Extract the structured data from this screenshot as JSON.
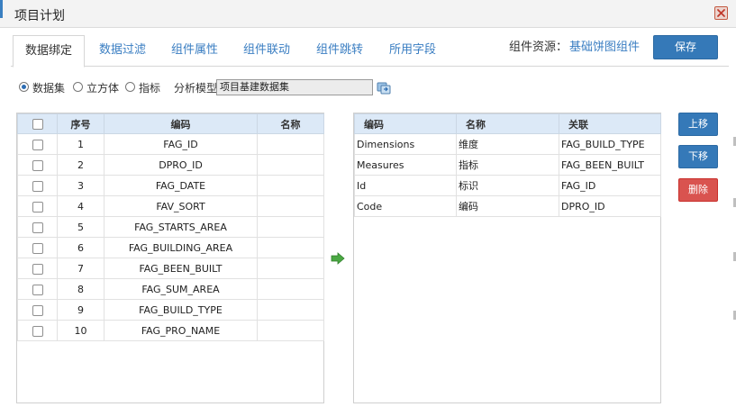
{
  "window": {
    "title": "项目计划"
  },
  "tabs": [
    {
      "label": "数据绑定",
      "active": true
    },
    {
      "label": "数据过滤",
      "active": false
    },
    {
      "label": "组件属性",
      "active": false
    },
    {
      "label": "组件联动",
      "active": false
    },
    {
      "label": "组件跳转",
      "active": false
    },
    {
      "label": "所用字段",
      "active": false
    }
  ],
  "component_resource": {
    "label": "组件资源：",
    "value": "基础饼图组件"
  },
  "toolbar": {
    "save_label": "保存"
  },
  "source_options": [
    {
      "label": "数据集",
      "selected": true
    },
    {
      "label": "立方体",
      "selected": false
    },
    {
      "label": "指标",
      "selected": false
    }
  ],
  "model": {
    "label": "分析模型",
    "value": "项目基建数据集"
  },
  "left_table": {
    "headers": {
      "index": "序号",
      "code": "编码",
      "name": "名称"
    },
    "rows": [
      {
        "index": "1",
        "code": "FAG_ID",
        "name": ""
      },
      {
        "index": "2",
        "code": "DPRO_ID",
        "name": ""
      },
      {
        "index": "3",
        "code": "FAG_DATE",
        "name": ""
      },
      {
        "index": "4",
        "code": "FAV_SORT",
        "name": ""
      },
      {
        "index": "5",
        "code": "FAG_STARTS_AREA",
        "name": ""
      },
      {
        "index": "6",
        "code": "FAG_BUILDING_AREA",
        "name": ""
      },
      {
        "index": "7",
        "code": "FAG_BEEN_BUILT",
        "name": ""
      },
      {
        "index": "8",
        "code": "FAG_SUM_AREA",
        "name": ""
      },
      {
        "index": "9",
        "code": "FAG_BUILD_TYPE",
        "name": ""
      },
      {
        "index": "10",
        "code": "FAG_PRO_NAME",
        "name": ""
      }
    ]
  },
  "right_table": {
    "headers": {
      "code": "编码",
      "name": "名称",
      "link": "关联"
    },
    "rows": [
      {
        "code": "Dimensions",
        "name": "维度",
        "link": "FAG_BUILD_TYPE"
      },
      {
        "code": "Measures",
        "name": "指标",
        "link": "FAG_BEEN_BUILT"
      },
      {
        "code": "Id",
        "name": "标识",
        "link": "FAG_ID"
      },
      {
        "code": "Code",
        "name": "编码",
        "link": "DPRO_ID"
      }
    ]
  },
  "side_buttons": {
    "up": "上移",
    "down": "下移",
    "delete": "删除"
  },
  "colors": {
    "accent_blue": "#3579b8",
    "tab_text": "#3a7ec2",
    "header_bg": "#dce9f7",
    "delete_red": "#d9534f",
    "arrow_green": "#4aa843"
  },
  "icons": {
    "close": "close-icon",
    "model_picker": "model-picker-icon",
    "move_right": "arrow-right-icon"
  }
}
